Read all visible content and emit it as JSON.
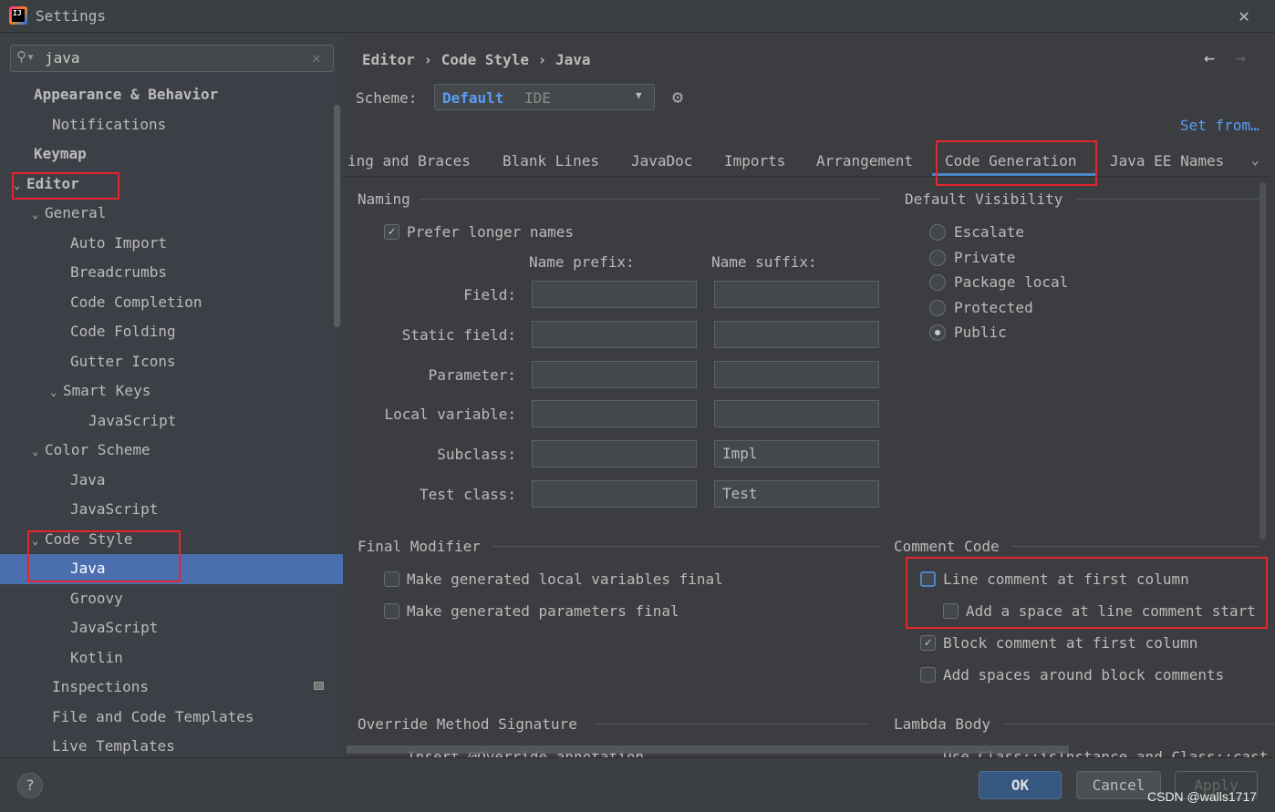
{
  "window": {
    "title": "Settings",
    "app_icon": "intellij-logo-icon"
  },
  "search": {
    "value": "java",
    "icon": "search-icon",
    "clear_icon": "close-icon"
  },
  "tree": [
    {
      "label": "Appearance & Behavior",
      "level": 0,
      "bold": true
    },
    {
      "label": "Notifications",
      "level": 1
    },
    {
      "label": "Keymap",
      "level": 0,
      "bold": true
    },
    {
      "label": "Editor",
      "level": 0,
      "bold": true,
      "expanded": true
    },
    {
      "label": "General",
      "level": 1,
      "expanded": true
    },
    {
      "label": "Auto Import",
      "level": 2
    },
    {
      "label": "Breadcrumbs",
      "level": 2
    },
    {
      "label": "Code Completion",
      "level": 2
    },
    {
      "label": "Code Folding",
      "level": 2
    },
    {
      "label": "Gutter Icons",
      "level": 2
    },
    {
      "label": "Smart Keys",
      "level": 2,
      "expanded": true
    },
    {
      "label": "JavaScript",
      "level": 3
    },
    {
      "label": "Color Scheme",
      "level": 1,
      "expanded": true
    },
    {
      "label": "Java",
      "level": 2
    },
    {
      "label": "JavaScript",
      "level": 2
    },
    {
      "label": "Code Style",
      "level": 1,
      "expanded": true
    },
    {
      "label": "Java",
      "level": 2,
      "selected": true
    },
    {
      "label": "Groovy",
      "level": 2
    },
    {
      "label": "JavaScript",
      "level": 2
    },
    {
      "label": "Kotlin",
      "level": 2
    },
    {
      "label": "Inspections",
      "level": 1
    },
    {
      "label": "File and Code Templates",
      "level": 1
    },
    {
      "label": "Live Templates",
      "level": 1
    }
  ],
  "breadcrumb": [
    "Editor",
    "Code Style",
    "Java"
  ],
  "scheme": {
    "label": "Scheme:",
    "name": "Default",
    "type": "IDE"
  },
  "set_from": "Set from…",
  "tabs": [
    "ing and Braces",
    "Blank Lines",
    "JavaDoc",
    "Imports",
    "Arrangement",
    "Code Generation",
    "Java EE Names"
  ],
  "active_tab": "Code Generation",
  "naming": {
    "title": "Naming",
    "prefer_longer": {
      "label": "Prefer longer names",
      "checked": true
    },
    "prefix_header": "Name prefix:",
    "suffix_header": "Name suffix:",
    "rows": [
      {
        "label": "Field:",
        "prefix": "",
        "suffix": ""
      },
      {
        "label": "Static field:",
        "prefix": "",
        "suffix": ""
      },
      {
        "label": "Parameter:",
        "prefix": "",
        "suffix": ""
      },
      {
        "label": "Local variable:",
        "prefix": "",
        "suffix": ""
      },
      {
        "label": "Subclass:",
        "prefix": "",
        "suffix": "Impl"
      },
      {
        "label": "Test class:",
        "prefix": "",
        "suffix": "Test"
      }
    ]
  },
  "visibility": {
    "title": "Default Visibility",
    "options": [
      "Escalate",
      "Private",
      "Package local",
      "Protected",
      "Public"
    ],
    "selected": "Public"
  },
  "final_modifier": {
    "title": "Final Modifier",
    "items": [
      {
        "label": "Make generated local variables final",
        "checked": false
      },
      {
        "label": "Make generated parameters final",
        "checked": false
      }
    ]
  },
  "comment_code": {
    "title": "Comment Code",
    "items": [
      {
        "label": "Line comment at first column",
        "checked": false
      },
      {
        "label": "Add a space at line comment start",
        "checked": false
      },
      {
        "label": "Block comment at first column",
        "checked": true
      },
      {
        "label": "Add spaces around block comments",
        "checked": false
      }
    ]
  },
  "override": {
    "title": "Override Method Signature",
    "item": "Insert @Override annotation"
  },
  "lambda": {
    "title": "Lambda Body",
    "item": "Use Class::isInstance and Class::cast"
  },
  "buttons": {
    "ok": "OK",
    "cancel": "Cancel",
    "apply": "Apply",
    "help": "?"
  },
  "watermark": "CSDN @walls1717",
  "colors": {
    "selection": "#4b6eaf",
    "link": "#589df6",
    "highlight_box": "#e5252a"
  }
}
